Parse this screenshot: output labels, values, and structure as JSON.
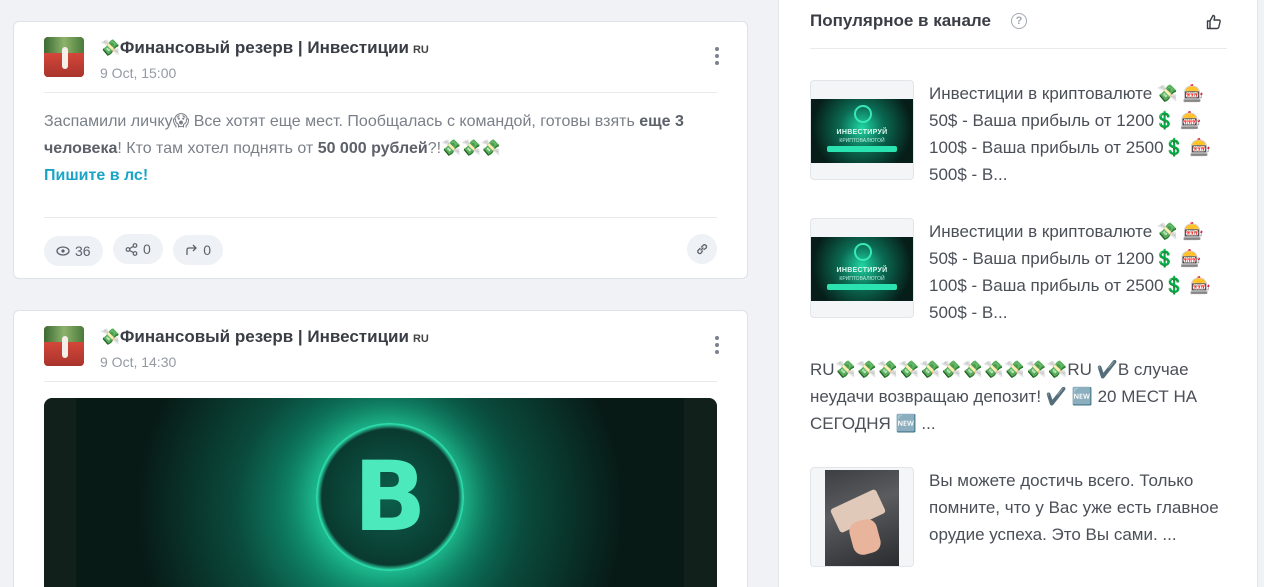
{
  "feed": {
    "posts": [
      {
        "channel_emoji": "💸",
        "channel_name": "Финансовый резерв | Инвестиции",
        "channel_flag": "RU",
        "date": "9 Oct, 15:00",
        "text_part1": "Заспамили личку😱 Все хотят еще мест. Пообщалась с командой, готовы взять ",
        "text_bold1": "еще 3 человека",
        "text_part2": "! Кто там хотел поднять от ",
        "text_bold2": "50 000 рублей",
        "text_part3": "?!💸💸💸",
        "text_link": "Пишите в лс!",
        "views": "36",
        "shares": "0",
        "forwards": "0"
      },
      {
        "channel_emoji": "💸",
        "channel_name": "Финансовый резерв | Инвестиции",
        "channel_flag": "RU",
        "date": "9 Oct, 14:30"
      }
    ]
  },
  "sidebar": {
    "title": "Популярное в канале",
    "help_icon": "?",
    "items": [
      {
        "thumb_title": "ИНВЕСТИРУЙ",
        "thumb_subtitle": "КРИПТОВАЛЮТОЙ",
        "text": "Инвестиции в криптовалюте 💸 🎰 50$ - Ваша прибыль от 1200💲 🎰 100$ - Ваша прибыль от 2500💲 🎰 500$ - В..."
      },
      {
        "thumb_title": "ИНВЕСТИРУЙ",
        "thumb_subtitle": "КРИПТОВАЛЮТОЙ",
        "text": "Инвестиции в криптовалюте 💸 🎰 50$ - Ваша прибыль от 1200💲 🎰 100$ - Ваша прибыль от 2500💲 🎰 500$ - В..."
      },
      {
        "text": "RU💸💸💸💸💸💸💸💸💸💸💸RU ✔️В случае неудачи возвращаю депозит! ✔️ 🆕 20 МЕСТ НА СЕГОДНЯ 🆕 ..."
      },
      {
        "text": "Вы можете достичь всего. Только помните, что у Вас уже есть главное орудие успеха. Это Вы сами. ..."
      }
    ]
  }
}
